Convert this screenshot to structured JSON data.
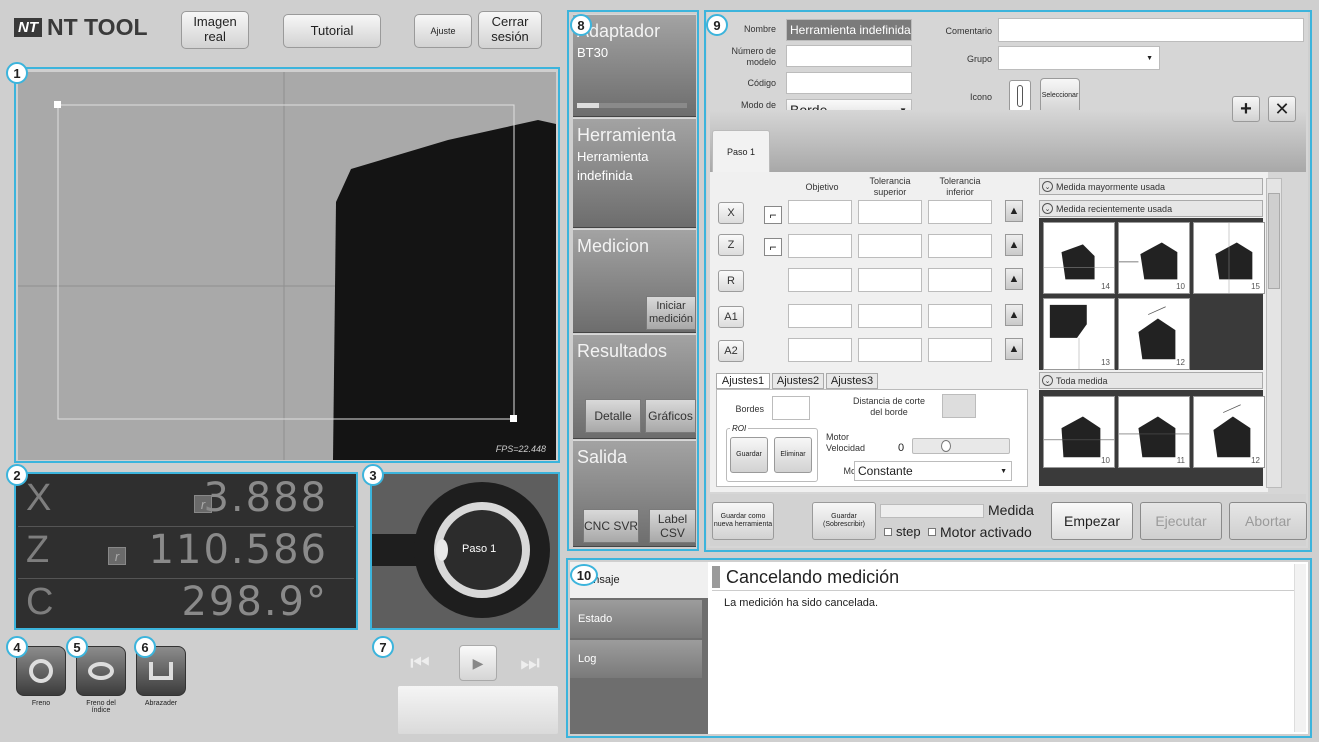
{
  "header": {
    "logo_mark": "NT",
    "logo_text": "NT TOOL",
    "btn_imagen": "Imagen real",
    "btn_tutorial": "Tutorial",
    "btn_ajuste": "Ajuste",
    "btn_cerrar": "Cerrar sesión"
  },
  "markers": [
    "1",
    "2",
    "3",
    "4",
    "5",
    "6",
    "7",
    "8",
    "9",
    "10"
  ],
  "camera": {
    "fps": "FPS=22.448"
  },
  "dro": [
    {
      "axis": "X",
      "value": "3.888",
      "chip": "r"
    },
    {
      "axis": "Z",
      "value": "110.586",
      "chip": "r"
    },
    {
      "axis": "C",
      "value": "298.9°"
    }
  ],
  "preview": {
    "label": "Paso 1"
  },
  "bottom_buttons": [
    {
      "label": "Freno"
    },
    {
      "label": "Freno del índice"
    },
    {
      "label": "Abrazader"
    }
  ],
  "sidebar": {
    "adaptador": {
      "title": "Adaptador",
      "sub": "BT30"
    },
    "herramienta": {
      "title": "Herramienta",
      "sub": "Herramienta indefinida"
    },
    "medicion": {
      "title": "Medicion",
      "btn": "Iniciar medición"
    },
    "resultados": {
      "title": "Resultados",
      "btn1": "Detalle",
      "btn2": "Gráficos"
    },
    "salida": {
      "title": "Salida",
      "btn1": "CNC SVR",
      "btn2": "Label CSV"
    }
  },
  "form": {
    "nombre_label": "Nombre",
    "nombre_value": "Herramienta indefinida",
    "modelo_label": "Número de modelo",
    "codigo_label": "Código",
    "modo_label": "Modo de medición",
    "modo_value": "Borde",
    "comentario_label": "Comentario",
    "grupo_label": "Grupo",
    "icono_label": "Icono",
    "seleccionar_btn": "Seleccionar",
    "tab_paso": "Paso 1",
    "col_objetivo": "Objetivo",
    "col_tol_sup": "Tolerancia superior",
    "col_tol_inf": "Tolerancia inferior",
    "axes": [
      "X",
      "Z",
      "R",
      "A1",
      "A2"
    ]
  },
  "accordion": {
    "mayormente": "Medida mayormente usada",
    "recientemente": "Medida recientemente usada",
    "toda": "Toda medida",
    "recent_nums": [
      "14",
      "10",
      "15",
      "13",
      "12"
    ],
    "all_nums": [
      "10",
      "11",
      "12"
    ]
  },
  "ajustes": {
    "tabs": [
      "Ajustes1",
      "Ajustes2",
      "Ajustes3"
    ],
    "bordes": "Bordes",
    "distancia": "Distancia de corte del borde",
    "roi": "ROI",
    "guardar": "Guardar",
    "eliminar": "Eliminar",
    "motor_vel": "Motor Velocidad",
    "motor_val": "0",
    "modo": "Modo",
    "modo_value": "Constante"
  },
  "actions": {
    "guardar_nueva": "Guardar como nueva herramienta",
    "guardar_sobre": "Guardar (Sobrescribir)",
    "medida": "Medida",
    "step": "step",
    "motor_activado": "Motor activado",
    "empezar": "Empezar",
    "ejecutar": "Ejecutar",
    "abortar": "Abortar"
  },
  "messages": {
    "tabs": [
      "Mensaje",
      "Estado",
      "Log"
    ],
    "title": "Cancelando medición",
    "body": "La medición ha sido cancelada."
  }
}
